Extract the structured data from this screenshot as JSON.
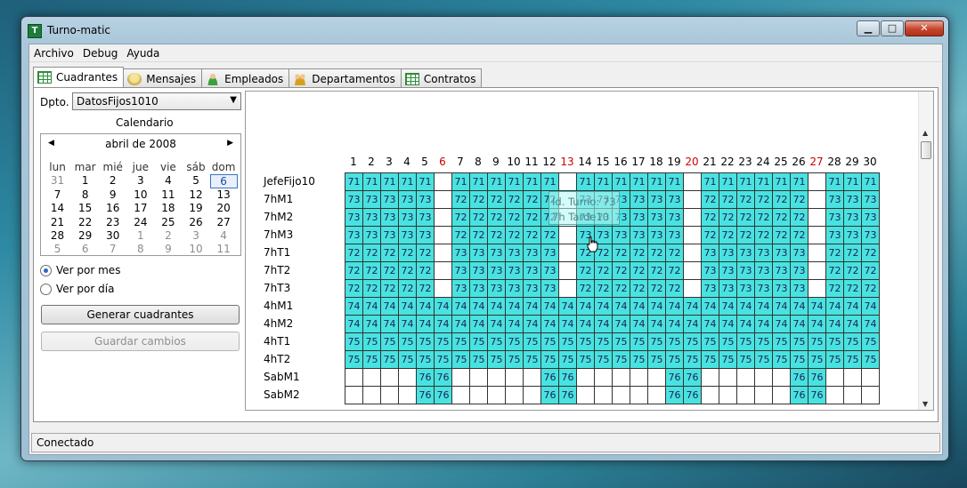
{
  "window": {
    "title": "Turno-matic"
  },
  "menu": [
    "Archivo",
    "Debug",
    "Ayuda"
  ],
  "tabs": [
    {
      "label": "Cuadrantes",
      "icon": "grid-icon",
      "active": true
    },
    {
      "label": "Mensajes",
      "icon": "message-icon",
      "active": false
    },
    {
      "label": "Empleados",
      "icon": "person-icon",
      "active": false
    },
    {
      "label": "Departamentos",
      "icon": "people-icon",
      "active": false
    },
    {
      "label": "Contratos",
      "icon": "grid-icon",
      "active": false
    }
  ],
  "sidebar": {
    "dpto_label": "Dpto.",
    "dpto_value": "DatosFijos1010",
    "calendar_title": "Calendario",
    "calendar": {
      "month": "abril de 2008",
      "weekdays": [
        "lun",
        "mar",
        "mié",
        "jue",
        "vie",
        "sáb",
        "dom"
      ],
      "weeks": [
        [
          [
            "31",
            "o"
          ],
          [
            "1",
            ""
          ],
          [
            "2",
            ""
          ],
          [
            "3",
            ""
          ],
          [
            "4",
            ""
          ],
          [
            "5",
            ""
          ],
          [
            "6",
            "t"
          ]
        ],
        [
          [
            "7",
            ""
          ],
          [
            "8",
            ""
          ],
          [
            "9",
            ""
          ],
          [
            "10",
            ""
          ],
          [
            "11",
            ""
          ],
          [
            "12",
            ""
          ],
          [
            "13",
            ""
          ]
        ],
        [
          [
            "14",
            ""
          ],
          [
            "15",
            ""
          ],
          [
            "16",
            ""
          ],
          [
            "17",
            ""
          ],
          [
            "18",
            ""
          ],
          [
            "19",
            ""
          ],
          [
            "20",
            ""
          ]
        ],
        [
          [
            "21",
            ""
          ],
          [
            "22",
            ""
          ],
          [
            "23",
            ""
          ],
          [
            "24",
            ""
          ],
          [
            "25",
            ""
          ],
          [
            "26",
            ""
          ],
          [
            "27",
            ""
          ]
        ],
        [
          [
            "28",
            ""
          ],
          [
            "29",
            ""
          ],
          [
            "30",
            ""
          ],
          [
            "1",
            "o"
          ],
          [
            "2",
            "o"
          ],
          [
            "3",
            "o"
          ],
          [
            "4",
            "o"
          ]
        ],
        [
          [
            "5",
            "o"
          ],
          [
            "6",
            "o"
          ],
          [
            "7",
            "o"
          ],
          [
            "8",
            "o"
          ],
          [
            "9",
            "o"
          ],
          [
            "10",
            "o"
          ],
          [
            "11",
            "o"
          ]
        ]
      ]
    },
    "radio_month": "Ver por mes",
    "radio_day": "Ver por día",
    "btn_generate": "Generar cuadrantes",
    "btn_save": "Guardar cambios"
  },
  "schedule": {
    "days": [
      "1",
      "2",
      "3",
      "4",
      "5",
      "6",
      "7",
      "8",
      "9",
      "10",
      "11",
      "12",
      "13",
      "14",
      "15",
      "16",
      "17",
      "18",
      "19",
      "20",
      "21",
      "22",
      "23",
      "24",
      "25",
      "26",
      "27",
      "28",
      "29",
      "30"
    ],
    "red_days": [
      "6",
      "13",
      "20",
      "27"
    ],
    "rows": [
      {
        "name": "JefeFijo10",
        "cells": [
          "71",
          "71",
          "71",
          "71",
          "71",
          "",
          "71",
          "71",
          "71",
          "71",
          "71",
          "71",
          "",
          "71",
          "71",
          "71",
          "71",
          "71",
          "71",
          "",
          "71",
          "71",
          "71",
          "71",
          "71",
          "71",
          "",
          "71",
          "71",
          "71"
        ]
      },
      {
        "name": "7hM1",
        "cells": [
          "73",
          "73",
          "73",
          "73",
          "73",
          "",
          "72",
          "72",
          "72",
          "72",
          "72",
          "72",
          "",
          "73",
          "73",
          "73",
          "73",
          "73",
          "73",
          "",
          "72",
          "72",
          "72",
          "72",
          "72",
          "72",
          "",
          "73",
          "73",
          "73"
        ]
      },
      {
        "name": "7hM2",
        "cells": [
          "73",
          "73",
          "73",
          "73",
          "73",
          "",
          "72",
          "72",
          "72",
          "72",
          "72",
          "72",
          "",
          "73",
          "73",
          "73",
          "73",
          "73",
          "73",
          "",
          "72",
          "72",
          "72",
          "72",
          "72",
          "72",
          "",
          "73",
          "73",
          "73"
        ]
      },
      {
        "name": "7hM3",
        "cells": [
          "73",
          "73",
          "73",
          "73",
          "73",
          "",
          "72",
          "72",
          "72",
          "72",
          "72",
          "72",
          "",
          "73",
          "73",
          "73",
          "73",
          "73",
          "73",
          "",
          "72",
          "72",
          "72",
          "72",
          "72",
          "72",
          "",
          "73",
          "73",
          "73"
        ]
      },
      {
        "name": "7hT1",
        "cells": [
          "72",
          "72",
          "72",
          "72",
          "72",
          "",
          "73",
          "73",
          "73",
          "73",
          "73",
          "73",
          "",
          "72",
          "72",
          "72",
          "72",
          "72",
          "72",
          "",
          "73",
          "73",
          "73",
          "73",
          "73",
          "73",
          "",
          "72",
          "72",
          "72"
        ]
      },
      {
        "name": "7hT2",
        "cells": [
          "72",
          "72",
          "72",
          "72",
          "72",
          "",
          "73",
          "73",
          "73",
          "73",
          "73",
          "73",
          "",
          "72",
          "72",
          "72",
          "72",
          "72",
          "72",
          "",
          "73",
          "73",
          "73",
          "73",
          "73",
          "73",
          "",
          "72",
          "72",
          "72"
        ]
      },
      {
        "name": "7hT3",
        "cells": [
          "72",
          "72",
          "72",
          "72",
          "72",
          "",
          "73",
          "73",
          "73",
          "73",
          "73",
          "73",
          "",
          "72",
          "72",
          "72",
          "72",
          "72",
          "72",
          "",
          "73",
          "73",
          "73",
          "73",
          "73",
          "73",
          "",
          "72",
          "72",
          "72"
        ]
      },
      {
        "name": "4hM1",
        "cells": [
          "74",
          "74",
          "74",
          "74",
          "74",
          "74",
          "74",
          "74",
          "74",
          "74",
          "74",
          "74",
          "74",
          "74",
          "74",
          "74",
          "74",
          "74",
          "74",
          "74",
          "74",
          "74",
          "74",
          "74",
          "74",
          "74",
          "74",
          "74",
          "74",
          "74"
        ]
      },
      {
        "name": "4hM2",
        "cells": [
          "74",
          "74",
          "74",
          "74",
          "74",
          "74",
          "74",
          "74",
          "74",
          "74",
          "74",
          "74",
          "74",
          "74",
          "74",
          "74",
          "74",
          "74",
          "74",
          "74",
          "74",
          "74",
          "74",
          "74",
          "74",
          "74",
          "74",
          "74",
          "74",
          "74"
        ]
      },
      {
        "name": "4hT1",
        "cells": [
          "75",
          "75",
          "75",
          "75",
          "75",
          "75",
          "75",
          "75",
          "75",
          "75",
          "75",
          "75",
          "75",
          "75",
          "75",
          "75",
          "75",
          "75",
          "75",
          "75",
          "75",
          "75",
          "75",
          "75",
          "75",
          "75",
          "75",
          "75",
          "75",
          "75"
        ]
      },
      {
        "name": "4hT2",
        "cells": [
          "75",
          "75",
          "75",
          "75",
          "75",
          "75",
          "75",
          "75",
          "75",
          "75",
          "75",
          "75",
          "75",
          "75",
          "75",
          "75",
          "75",
          "75",
          "75",
          "75",
          "75",
          "75",
          "75",
          "75",
          "75",
          "75",
          "75",
          "75",
          "75",
          "75"
        ]
      },
      {
        "name": "SabM1",
        "cells": [
          "",
          "",
          "",
          "",
          "76",
          "76",
          "",
          "",
          "",
          "",
          "",
          "76",
          "76",
          "",
          "",
          "",
          "",
          "",
          "76",
          "76",
          "",
          "",
          "",
          "",
          "",
          "76",
          "76",
          "",
          "",
          ""
        ]
      },
      {
        "name": "SabM2",
        "cells": [
          "",
          "",
          "",
          "",
          "76",
          "76",
          "",
          "",
          "",
          "",
          "",
          "76",
          "76",
          "",
          "",
          "",
          "",
          "",
          "76",
          "76",
          "",
          "",
          "",
          "",
          "",
          "76",
          "76",
          "",
          "",
          ""
        ]
      }
    ],
    "tooltip_line1": "Id. Turno: 73",
    "tooltip_line2": "7h Tarde10"
  },
  "status": {
    "text": "Conectado"
  },
  "colors": {
    "filled_cell": "#48e3e0",
    "weekend_day": "#cc0000"
  }
}
